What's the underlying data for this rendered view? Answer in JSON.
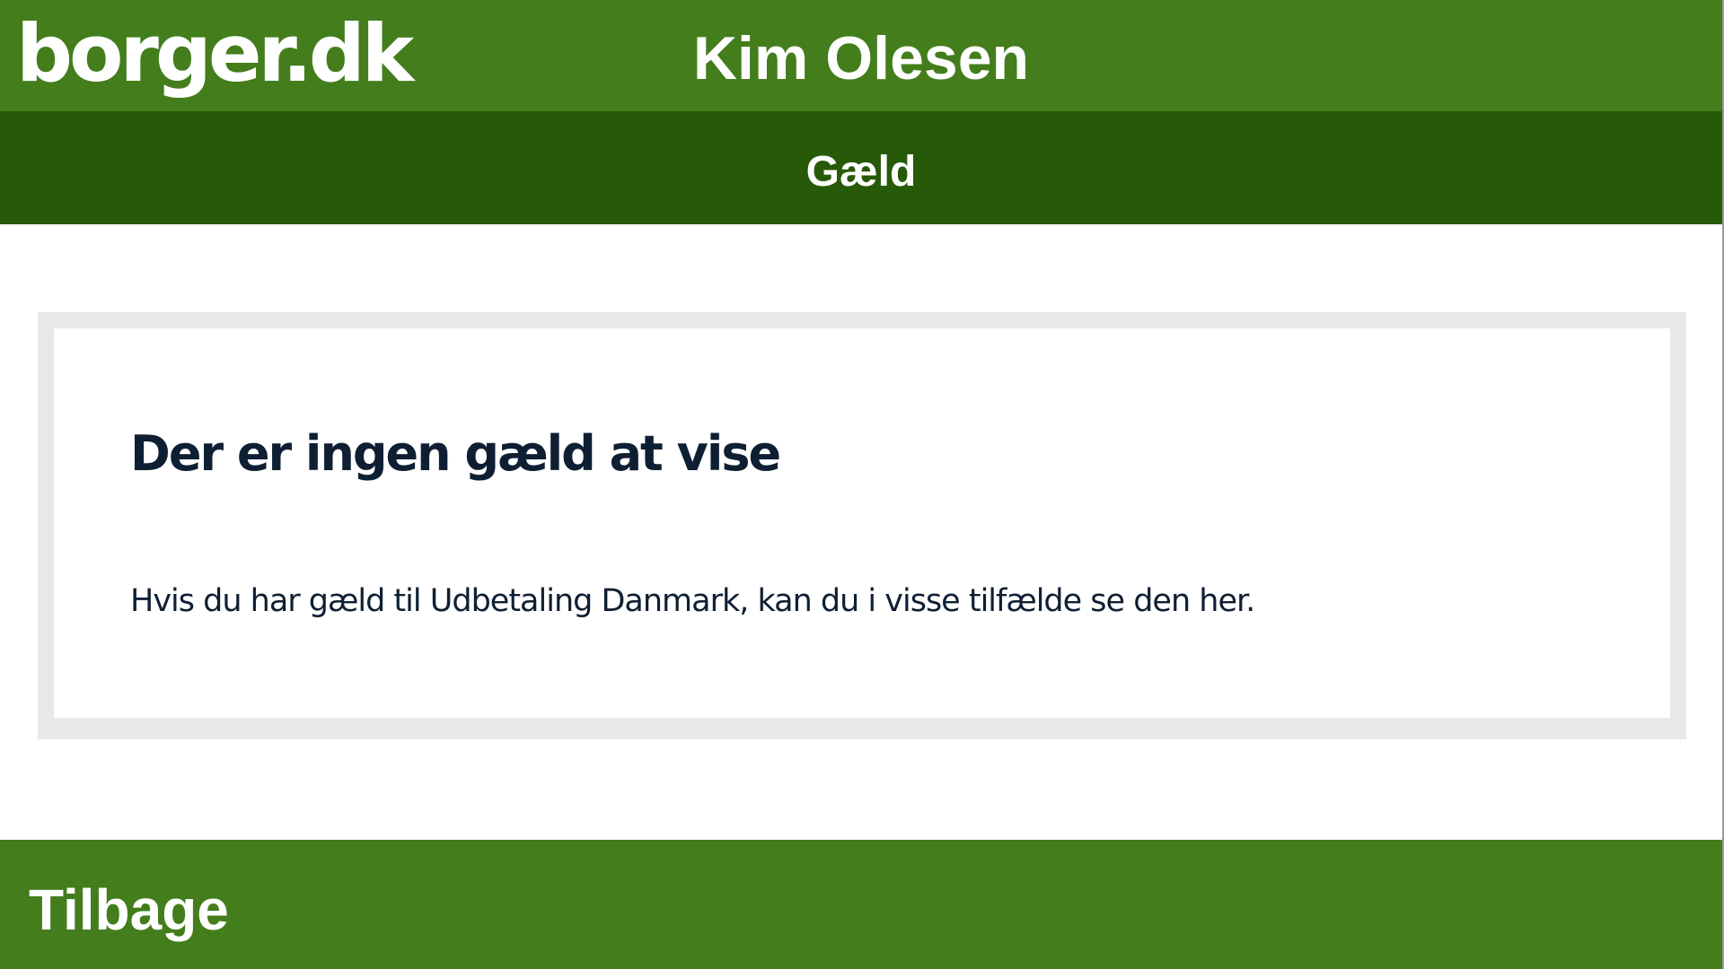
{
  "header": {
    "logo_text": "borger.dk",
    "user_name": "Kim Olesen"
  },
  "subheader": {
    "title": "Gæld"
  },
  "card": {
    "heading": "Der er ingen gæld at vise",
    "text": "Hvis du har gæld til Udbetaling Danmark, kan du i visse tilfælde se den her."
  },
  "footer": {
    "back_label": "Tilbage"
  },
  "colors": {
    "header_green": "#437d1c",
    "subheader_green": "#275a08",
    "card_border": "#e7e8ea",
    "heading_text": "#0f1f33"
  }
}
